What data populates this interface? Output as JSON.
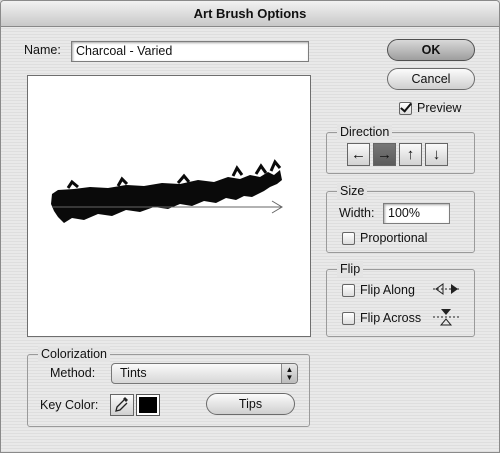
{
  "window": {
    "title": "Art Brush Options"
  },
  "name": {
    "label": "Name:",
    "value": "Charcoal - Varied"
  },
  "buttons": {
    "ok": "OK",
    "cancel": "Cancel",
    "tips": "Tips"
  },
  "preview": {
    "label": "Preview",
    "checked": true
  },
  "direction": {
    "title": "Direction",
    "options": [
      "←",
      "→",
      "↑",
      "↓"
    ],
    "selected_index": 1
  },
  "size": {
    "title": "Size",
    "width_label": "Width:",
    "width_value": "100%",
    "proportional_label": "Proportional",
    "proportional_checked": false
  },
  "flip": {
    "title": "Flip",
    "along_label": "Flip Along",
    "along_checked": false,
    "across_label": "Flip Across",
    "across_checked": false
  },
  "colorization": {
    "title": "Colorization",
    "method_label": "Method:",
    "method_value": "Tints",
    "key_color_label": "Key Color:",
    "key_color": "#000000"
  }
}
